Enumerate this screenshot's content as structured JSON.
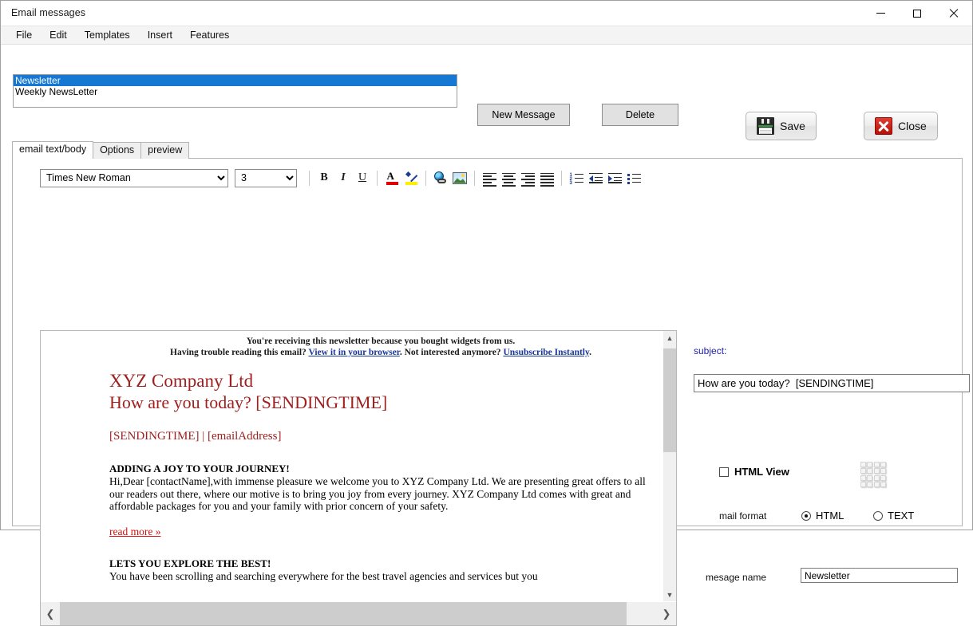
{
  "window": {
    "title": "Email messages",
    "controls": {
      "minimize": "minimize-button",
      "maximize": "maximize-button",
      "close": "close-button"
    }
  },
  "menubar": {
    "items": [
      "File",
      "Edit",
      "Templates",
      "Insert",
      "Features"
    ]
  },
  "message_list": {
    "items": [
      {
        "label": "Newsletter",
        "selected": true
      },
      {
        "label": "Weekly NewsLetter",
        "selected": false
      }
    ]
  },
  "toolbar": {
    "new_message": "New Message",
    "delete": "Delete",
    "save": "Save",
    "close": "Close"
  },
  "tabs": [
    {
      "label": "email text/body",
      "active": true
    },
    {
      "label": "Options",
      "active": false
    },
    {
      "label": "preview",
      "active": false
    }
  ],
  "editor_toolbar": {
    "font_family": "Times New Roman",
    "font_size": "3",
    "bold": "B",
    "italic": "I",
    "underline": "U",
    "buttons": [
      "font-color-icon",
      "highlight-icon",
      "insert-link-icon",
      "insert-image-icon",
      "align-left-icon",
      "align-center-icon",
      "align-right-icon",
      "align-justify-icon",
      "numbered-list-icon",
      "decrease-indent-icon",
      "increase-indent-icon",
      "bulleted-list-icon"
    ]
  },
  "email_body": {
    "preheader_line1": "You're receiving this newsletter because you bought widgets from us.",
    "preheader_line2_pre": "Having trouble reading this email? ",
    "preheader_link1": "View it in your browser",
    "preheader_line2_mid": ". Not interested anymore? ",
    "preheader_link2": "Unsubscribe Instantly",
    "preheader_line2_end": ".",
    "heading1": "XYZ Company Ltd",
    "heading2": "How are you today? [SENDINGTIME]",
    "meta": "[SENDINGTIME] | [emailAddress]",
    "section1_title": "ADDING A JOY TO YOUR JOURNEY!",
    "section1_body": "Hi,Dear [contactName],with immense pleasure we welcome you to XYZ Company Ltd. We are presenting great offers to all our readers out there, where our motive is to bring you joy from every journey. XYZ Company Ltd comes with great and affordable packages for you and your family with prior concern of your safety.",
    "read_more": "read more »",
    "section2_title": "LETS YOU EXPLORE THE BEST!",
    "section2_body": "You have been scrolling and searching everywhere for the best travel agencies and services but you"
  },
  "right_pane": {
    "subject_label": "subject:",
    "subject_value": "How are you today?  [SENDINGTIME]",
    "html_view_label": "HTML View",
    "html_view_checked": false,
    "grid_icon": "grid-icon",
    "mail_format_label": "mail format",
    "format_html": "HTML",
    "format_text": "TEXT",
    "format_selected": "HTML",
    "message_name_label": "mesage name",
    "message_name_value": "Newsletter"
  },
  "colors": {
    "accent_selection": "#1578d3",
    "heading_red": "#a01f1f",
    "link_blue": "#17369c",
    "label_blue": "#2222aa",
    "read_more_red": "#d01010"
  }
}
